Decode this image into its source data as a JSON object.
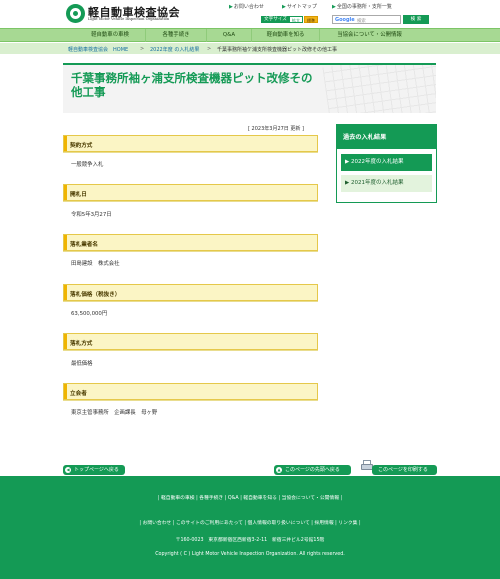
{
  "header": {
    "logo_jp": "軽自動車検査協会",
    "logo_en": "Light Motor Vehicle Inspection Organization",
    "links": [
      "お問い合わせ",
      "サイトマップ",
      "全国の事務所・支所一覧"
    ],
    "font_size_label": "文字サイズ",
    "font_size_standard": "標準",
    "font_size_large": "拡大",
    "search_logo": "Google",
    "search_placeholder": "検索",
    "search_button": "検 索"
  },
  "nav": {
    "items": [
      "軽自動車の車検",
      "各種手続き",
      "Q&A",
      "軽自動車を知る",
      "当協会について・公開情報"
    ]
  },
  "breadcrumb": {
    "items": [
      "軽自動車検査協会　HOME",
      "2022年度 の入札結果",
      "千葉事務所袖ケ浦支所検査機器ピット改修その他工事"
    ],
    "separator": ">"
  },
  "page": {
    "title": "千葉事務所袖ヶ浦支所検査機器ピット改修その他工事",
    "updated": "[ 2023年3月27日  更新 ]",
    "sections": [
      {
        "heading": "契約方式",
        "value": "一般競争入札"
      },
      {
        "heading": "開札日",
        "value": "令和5年3月27日"
      },
      {
        "heading": "落札業者名",
        "value": "田島建設　株式会社"
      },
      {
        "heading": "落札価格（税抜き）",
        "value": "63,500,000円"
      },
      {
        "heading": "落札方式",
        "value": "最低価格"
      },
      {
        "heading": "立会者",
        "value": "東京主管事務所　企画課長　母ヶ野"
      }
    ]
  },
  "sidebar": {
    "title": "過去の入札結果",
    "items": [
      "▶ 2022年度の入札結果",
      "▶ 2021年度の入札結果"
    ]
  },
  "page_buttons": {
    "top": "トップページへ戻る",
    "back": "このページの先頭へ戻る",
    "print": "このページを印刷する"
  },
  "footer": {
    "nav_row": "| 軽自動車の車検 | 各種手続き | Q&A | 軽自動車を知る | 当協会について・公開情報 |",
    "sub_row": "| お問い合わせ | このサイトのご利用にあたって | 個人情報の取り扱いについて | 採用情報 | リンク集 |",
    "address": "〒160-0023　東京都新宿区西新宿3-2-11　新宿三井ビル2号館15階",
    "copyright": "Copyright ( C ) Light Motor Vehicle Inspection Organization. All rights reserved."
  },
  "colors": {
    "brand_green": "#149a55",
    "nav_green": "#a7d993",
    "section_yellow": "#fbf5c5",
    "accent_orange": "#f0b400"
  }
}
